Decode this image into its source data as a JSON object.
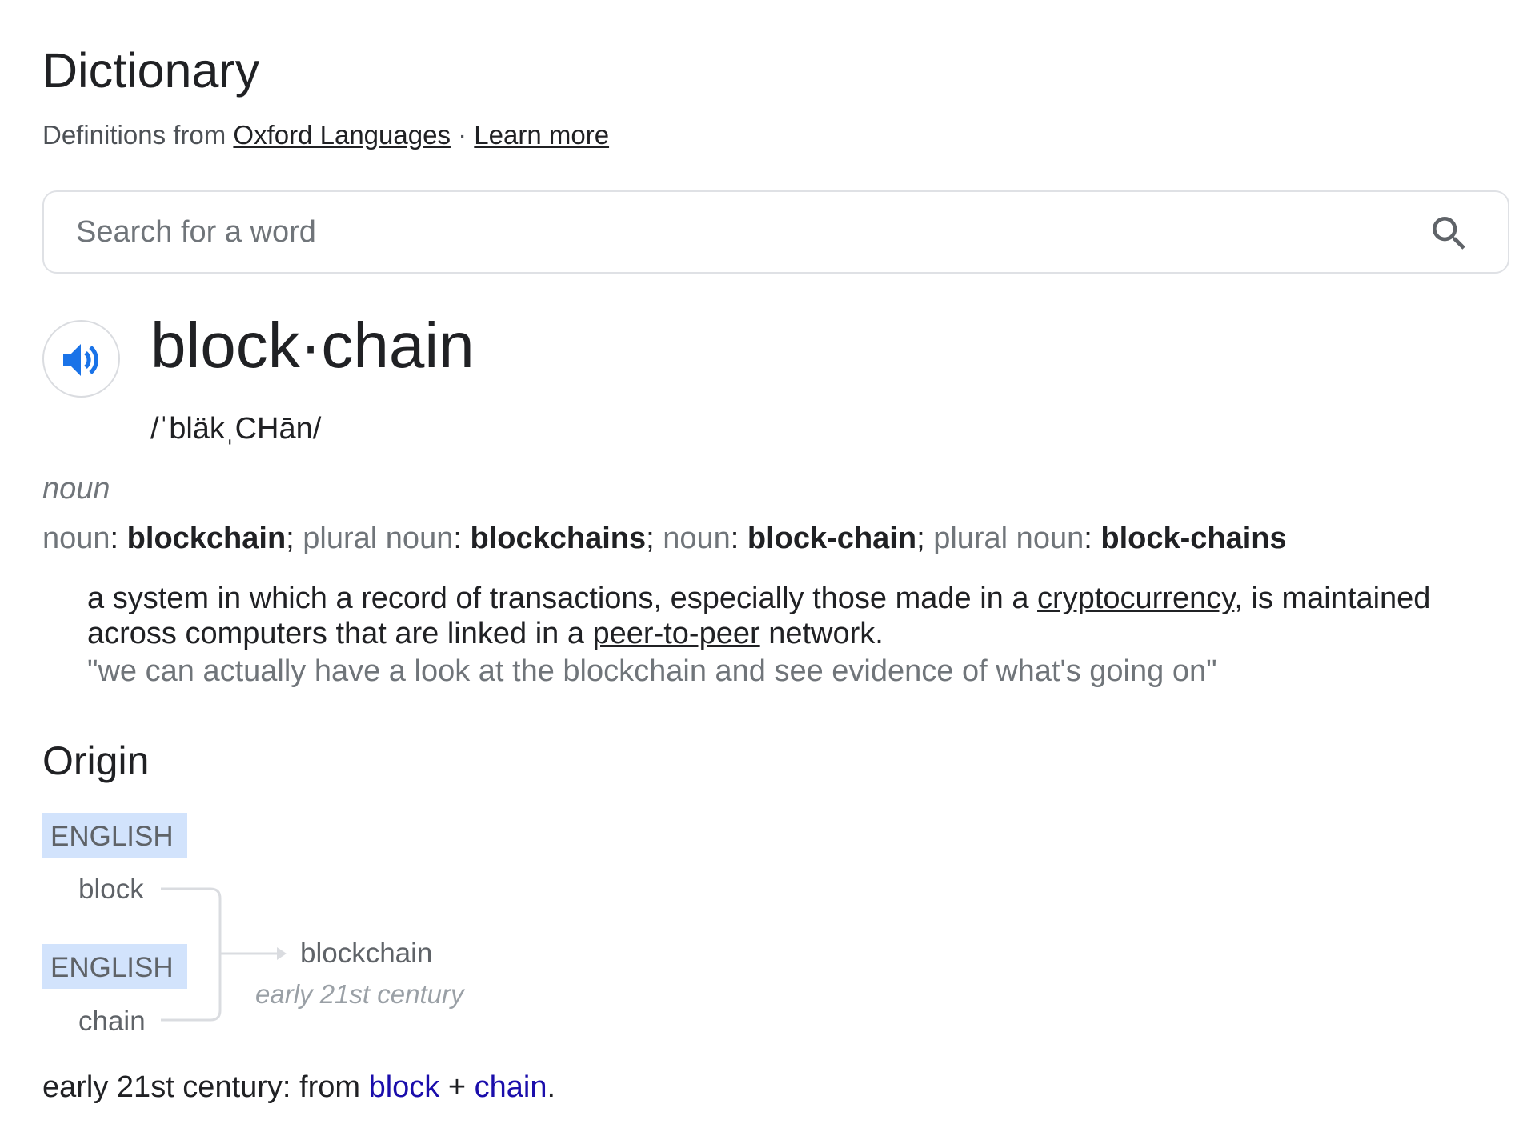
{
  "section": {
    "title": "Dictionary",
    "source_prefix": "Definitions from",
    "source_link": "Oxford Languages",
    "separator": "·",
    "learn_more": "Learn more"
  },
  "search": {
    "placeholder": "Search for a word",
    "icon": "search-icon"
  },
  "entry": {
    "audio_icon": "speaker-icon",
    "headword": "block·chain",
    "phonetic": "/ˈbläkˌCHān/",
    "part_of_speech": "noun",
    "forms": [
      {
        "label": "noun",
        "value": "blockchain"
      },
      {
        "label": "plural noun",
        "value": "blockchains"
      },
      {
        "label": "noun",
        "value": "block-chain"
      },
      {
        "label": "plural noun",
        "value": "block-chains"
      }
    ],
    "definition": {
      "text_1": "a system in which a record of transactions, especially those made in a ",
      "link_1": "cryptocurrency",
      "text_2": ", is maintained across computers that are linked in a ",
      "link_2": "peer-to-peer",
      "text_3": " network."
    },
    "example": "\"we can actually have a look at the blockchain and see evidence of what's going on\""
  },
  "origin": {
    "title": "Origin",
    "diagram": {
      "language_1": "ENGLISH",
      "word_1": "block",
      "language_2": "ENGLISH",
      "word_2": "chain",
      "result_word": "blockchain",
      "result_date": "early 21st century"
    },
    "text_prefix": "early 21st century: from ",
    "link_1": "block",
    "plus": " + ",
    "link_2": "chain",
    "suffix": "."
  },
  "colors": {
    "link": "#1a0dab",
    "language_tag_bg": "#d2e3fc",
    "audio_icon": "#1a73e8",
    "muted_text": "#70757a"
  }
}
